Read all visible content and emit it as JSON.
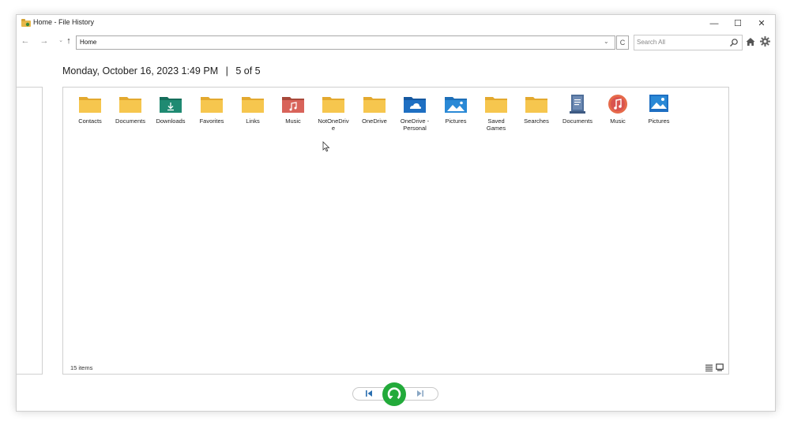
{
  "window": {
    "title": "Home - File History",
    "controls": {
      "minimize": "—",
      "maximize": "☐",
      "close": "✕"
    }
  },
  "toolbar": {
    "back": "←",
    "forward": "→",
    "recent": "⌄",
    "up": "↑",
    "address": "Home",
    "address_dropdown": "⌄",
    "refresh": "C",
    "search_placeholder": "Search All"
  },
  "timestamp": {
    "date": "Monday, October 16, 2023 1:49 PM",
    "separator": "|",
    "position": "5 of 5"
  },
  "items": [
    {
      "name": "Contacts",
      "icon": "folder-icon"
    },
    {
      "name": "Documents",
      "icon": "folder-icon"
    },
    {
      "name": "Downloads",
      "icon": "downloads-folder-icon"
    },
    {
      "name": "Favorites",
      "icon": "folder-icon"
    },
    {
      "name": "Links",
      "icon": "folder-icon"
    },
    {
      "name": "Music",
      "icon": "music-folder-icon"
    },
    {
      "name": "NotOneDrive",
      "icon": "folder-icon"
    },
    {
      "name": "OneDrive",
      "icon": "folder-icon"
    },
    {
      "name": "OneDrive - Personal",
      "icon": "onedrive-folder-icon"
    },
    {
      "name": "Pictures",
      "icon": "pictures-folder-icon"
    },
    {
      "name": "Saved Games",
      "icon": "folder-icon"
    },
    {
      "name": "Searches",
      "icon": "folder-icon"
    },
    {
      "name": "Documents",
      "icon": "documents-library-icon"
    },
    {
      "name": "Music",
      "icon": "music-library-icon"
    },
    {
      "name": "Pictures",
      "icon": "pictures-library-icon"
    }
  ],
  "status": {
    "item_count": "15 items"
  },
  "playback": {
    "previous": "previous-version-icon",
    "restore": "restore-icon",
    "next": "next-version-icon"
  },
  "colors": {
    "folder": "#f2c14e",
    "restore_button": "#22aa3a",
    "downloads": "#1f8a72",
    "onedrive": "#1e6fc2"
  }
}
